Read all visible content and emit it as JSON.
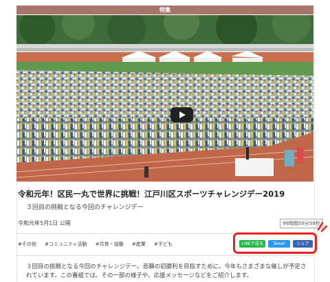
{
  "header": {
    "label": "特集"
  },
  "article": {
    "title": "令和元年！区民一丸で世界に挑戦！江戸川区スポーツチャレンジデー2019",
    "subtitle": "３回目の挑戦となる今回のチャレンジデー",
    "date": "令和元年5月1日 公開",
    "duration": "99時間59分59秒",
    "tags": [
      "#その他",
      "#コミュニティ活動",
      "#共育・協働",
      "#産業",
      "#子ども"
    ],
    "description": "３回目の挑戦となる今回のチャレンジデー。悲願の初勝利を目指すために、今年もさまざまな催しが予定されています。この番組では、その一部の様子や、応援メッセージなどをご紹介します。"
  },
  "share": {
    "line": "LINEで送る",
    "twitter": "Tweet",
    "facebook": "シェア"
  },
  "colors": {
    "header": "#a7766a",
    "highlight": "#e8221b",
    "line": "#2bb84a",
    "twitter": "#2b97e8",
    "facebook": "#3b66b2"
  }
}
